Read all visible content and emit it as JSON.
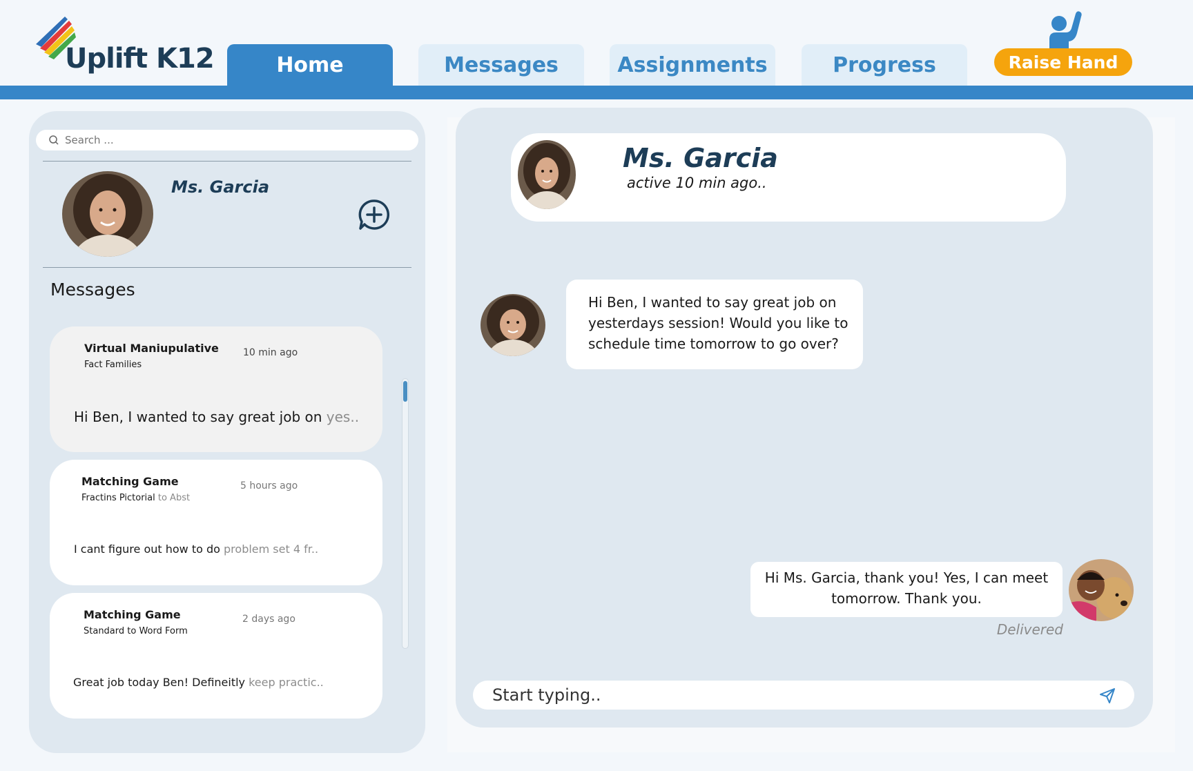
{
  "app": {
    "name": "Uplift K12"
  },
  "nav": {
    "tabs": [
      {
        "label": "Home",
        "active": true
      },
      {
        "label": "Messages",
        "active": false
      },
      {
        "label": "Assignments",
        "active": false
      },
      {
        "label": "Progress",
        "active": false
      }
    ],
    "raise_hand_label": "Raise Hand"
  },
  "sidebar": {
    "search_placeholder": "Search ...",
    "profile_name": "Ms. Garcia",
    "messages_heading": "Messages",
    "threads": [
      {
        "title": "Virtual Maniupulative",
        "subtitle": "Fact Families",
        "subtitle_fade": "",
        "time": "10 min ago",
        "preview": "Hi Ben,  I wanted to say great job on ",
        "preview_fade": "yes..",
        "selected": true
      },
      {
        "title": "Matching Game",
        "subtitle": "Fractins Pictorial ",
        "subtitle_fade": "to Abst",
        "time": "5 hours ago",
        "preview": "I cant figure out how to  do ",
        "preview_fade": "problem set 4 fr..",
        "selected": false
      },
      {
        "title": "Matching Game",
        "subtitle": "Standard to Word Form",
        "subtitle_fade": "",
        "time": "2 days ago",
        "preview": "Great job today Ben! Defineitly ",
        "preview_fade": "keep practic..",
        "selected": false
      }
    ]
  },
  "chat": {
    "contact_name": "Ms. Garcia",
    "contact_status": "active 10 min ago..",
    "messages": [
      {
        "from": "teacher",
        "text": "Hi Ben, I wanted to say great job on yesterdays session! Would you like to schedule time tomorrow to go over?"
      },
      {
        "from": "student",
        "text": "Hi Ms. Garcia, thank you! Yes, I can meet tomorrow. Thank you.",
        "status": "Delivered"
      }
    ],
    "compose_placeholder": "Start typing.."
  },
  "colors": {
    "brand_blue": "#3686c8",
    "navy": "#1d3d57",
    "raise_hand_orange": "#f5a40d",
    "panel": "#dfe8f0"
  },
  "icons": [
    "logo-mark-icon",
    "raised-hand-icon",
    "search-icon",
    "new-chat-plus-icon",
    "send-icon"
  ]
}
